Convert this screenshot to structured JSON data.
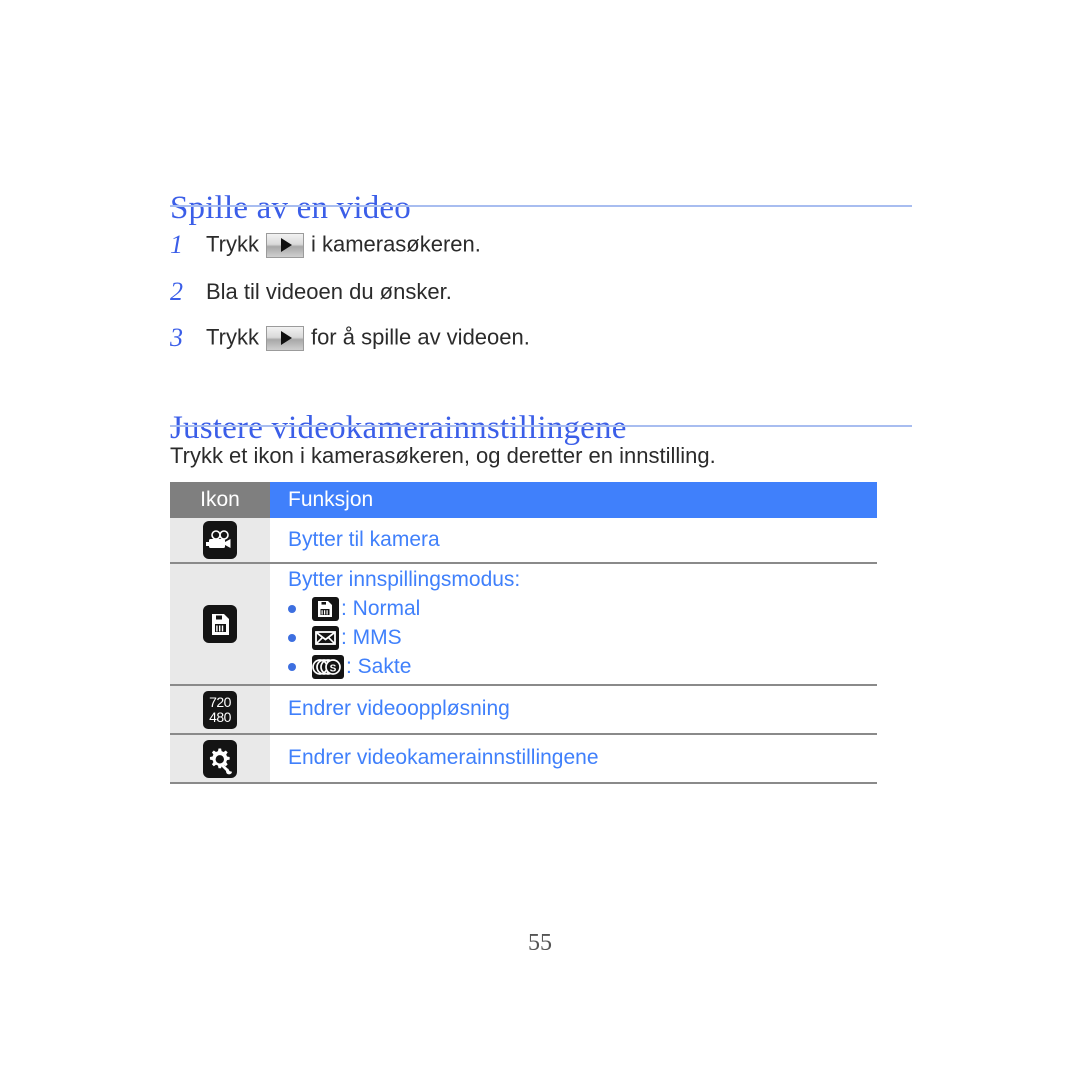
{
  "document": {
    "page_number": "55"
  },
  "sections": [
    {
      "heading": "Spille av en video",
      "steps": [
        {
          "number": "1",
          "text_before": "Trykk",
          "icon": "play-icon",
          "text_after": "i kamerasøkeren."
        },
        {
          "number": "2",
          "text_before": "Bla til videoen du ønsker.",
          "icon": "",
          "text_after": ""
        },
        {
          "number": "3",
          "text_before": "Trykk",
          "icon": "play-icon",
          "text_after": "for å spille av videoen."
        }
      ]
    },
    {
      "heading": "Justere videokamerainnstillingene",
      "intro": "Trykk et ikon i kamerasøkeren, og deretter en innstilling."
    }
  ],
  "table": {
    "headers": {
      "icon": "Ikon",
      "function": "Funksjon"
    },
    "rows": [
      {
        "icon_name": "video-camera-icon",
        "function": "Bytter til kamera",
        "bullets": []
      },
      {
        "icon_name": "recording-mode-icon",
        "function": "Bytter innspillingsmodus:",
        "bullets": [
          {
            "icon_name": "normal-mode-icon",
            "label": ": Normal"
          },
          {
            "icon_name": "mms-envelope-icon",
            "label": ": MMS"
          },
          {
            "icon_name": "slow-motion-icon",
            "label": ": Sakte"
          }
        ]
      },
      {
        "icon_name": "video-resolution-icon",
        "icon_text_top": "720",
        "icon_text_bottom": "480",
        "function": "Endrer videooppløsning",
        "bullets": []
      },
      {
        "icon_name": "camcorder-settings-icon",
        "function": "Endrer videokamerainnstillingene",
        "bullets": []
      }
    ]
  },
  "colors": {
    "heading_blue": "#3b5ee8",
    "link_blue": "#4080fb",
    "header_gray": "#7f7f7f",
    "rule_blue": "#a8bdf0",
    "icon_cell_bg": "#e9e9e9"
  }
}
